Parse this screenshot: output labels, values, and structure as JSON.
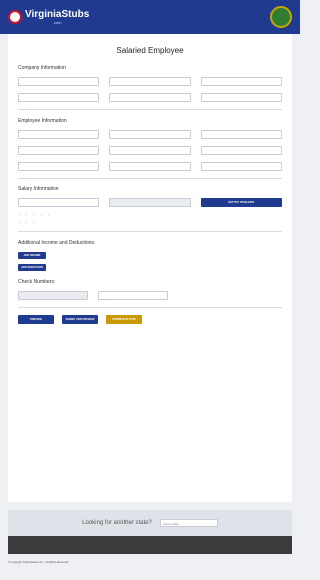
{
  "header": {
    "brand": "VirginiaStubs",
    "sub": ".com"
  },
  "title": "Salaried Employee",
  "company": {
    "title": "Company Information"
  },
  "employee": {
    "title": "Employee Information"
  },
  "salary": {
    "title": "Salary Information",
    "btn": "GET PAY STUB DATA"
  },
  "additional": {
    "title": "Additional Income and Deductions:",
    "add_income": "ADD INCOME",
    "add_deduction": "ADD DEDUCTION"
  },
  "check": {
    "title": "Check Numbers:"
  },
  "actions": {
    "preview": "PREVIEW",
    "submit": "SUBMIT AND PREVIEW",
    "download": "DOWNLOAD STUB"
  },
  "lookbar": {
    "title": "Looking for another state?",
    "select": "Select State"
  },
  "footer": {
    "copyright": "© Copyright VirginiaStubs.com · All Rights Reserved."
  }
}
